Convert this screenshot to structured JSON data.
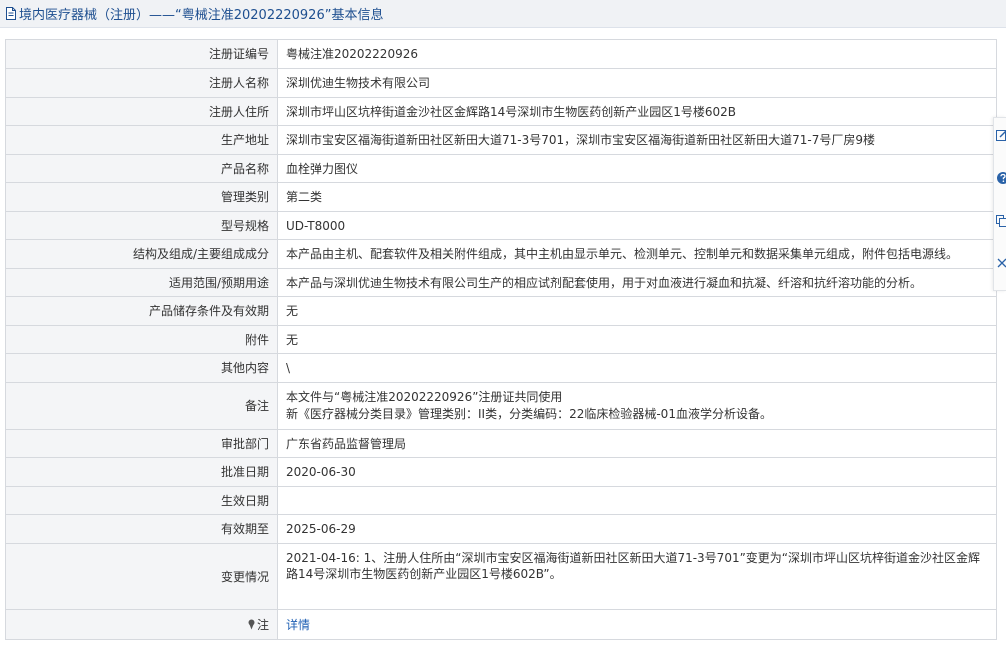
{
  "header": {
    "title": "境内医疗器械（注册）——“粤械注准20202220926”基本信息"
  },
  "rows": [
    {
      "label": "注册证编号",
      "value": "粤械注准20202220926"
    },
    {
      "label": "注册人名称",
      "value": "深圳优迪生物技术有限公司"
    },
    {
      "label": "注册人住所",
      "value": "深圳市坪山区坑梓街道金沙社区金辉路14号深圳市生物医药创新产业园区1号楼602B"
    },
    {
      "label": "生产地址",
      "value": "深圳市宝安区福海街道新田社区新田大道71-3号701，深圳市宝安区福海街道新田社区新田大道71-7号厂房9楼"
    },
    {
      "label": "产品名称",
      "value": "血栓弹力图仪"
    },
    {
      "label": "管理类别",
      "value": "第二类"
    },
    {
      "label": "型号规格",
      "value": "UD-T8000"
    },
    {
      "label": "结构及组成/主要组成成分",
      "value": "本产品由主机、配套软件及相关附件组成，其中主机由显示单元、检测单元、控制单元和数据采集单元组成，附件包括电源线。"
    },
    {
      "label": "适用范围/预期用途",
      "value": "本产品与深圳优迪生物技术有限公司生产的相应试剂配套使用，用于对血液进行凝血和抗凝、纤溶和抗纤溶功能的分析。"
    },
    {
      "label": "产品储存条件及有效期",
      "value": "无"
    },
    {
      "label": "附件",
      "value": "无"
    },
    {
      "label": "其他内容",
      "value": "\\"
    },
    {
      "label": "备注",
      "line1": "本文件与“粤械注准20202220926”注册证共同使用",
      "line2": "新《医疗器械分类目录》管理类别：II类，分类编码：22临床检验器械-01血液学分析设备。"
    },
    {
      "label": "审批部门",
      "value": "广东省药品监督管理局"
    },
    {
      "label": "批准日期",
      "value": "2020-06-30"
    },
    {
      "label": "生效日期",
      "value": ""
    },
    {
      "label": "有效期至",
      "value": "2025-06-29"
    },
    {
      "label": "变更情况",
      "value": "2021-04-16: 1、注册人住所由“深圳市宝安区福海街道新田社区新田大道71-3号701”变更为“深圳市坪山区坑梓街道金沙社区金辉路14号深圳市生物医药创新产业园区1号楼602B”。"
    },
    {
      "label": "注",
      "link": "详情"
    }
  ],
  "icons": {
    "doc": "document-icon",
    "pin": "pin-icon",
    "side": [
      "edit-icon",
      "help-icon",
      "copy-icon",
      "close-icon"
    ]
  },
  "colors": {
    "title": "#1e4f90",
    "link": "#1e5fb4",
    "label_bg": "#f4f5f7",
    "border": "#d6d9de"
  }
}
